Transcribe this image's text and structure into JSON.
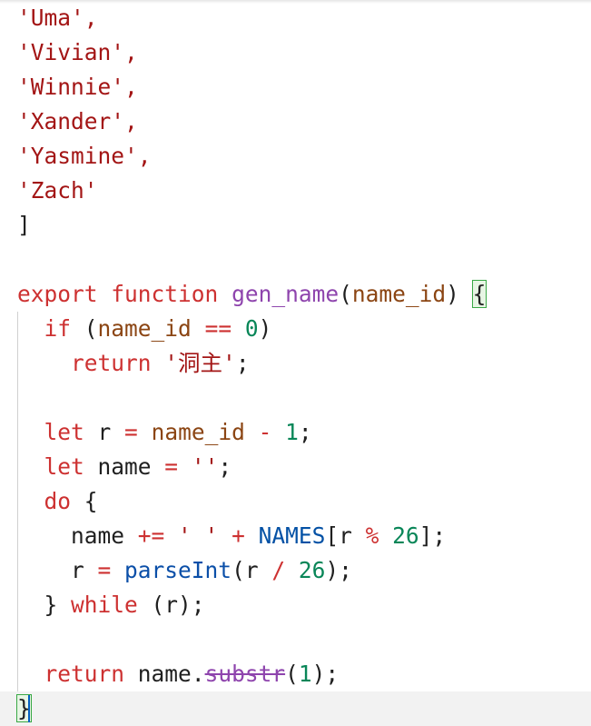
{
  "editor": {
    "names_tail": [
      "'Uma',",
      "'Vivian',",
      "'Winnie',",
      "'Xander',",
      "'Yasmine',",
      "'Zach'"
    ],
    "array_close": "]",
    "fn_decl": {
      "export_kw": "export",
      "function_kw": "function",
      "fn_name": "gen_name",
      "open_paren": "(",
      "param": "name_id",
      "close_paren": ")",
      "space": " ",
      "open_brace": "{"
    },
    "if_line": {
      "indent": "  ",
      "kw": "if",
      "open": " (",
      "var": "name_id",
      "op": " == ",
      "num": "0",
      "close": ")"
    },
    "return1": {
      "indent": "    ",
      "kw": "return",
      "space": " ",
      "str": "'洞主'",
      "semi": ";"
    },
    "let_r": {
      "indent": "  ",
      "kw": "let",
      "rest1": " r ",
      "op": "=",
      "space": " ",
      "var": "name_id",
      "op2": " - ",
      "num": "1",
      "semi": ";"
    },
    "let_name": {
      "indent": "  ",
      "kw": "let",
      "rest1": " name ",
      "op": "=",
      "space": " ",
      "str": "''",
      "semi": ";"
    },
    "do_line": {
      "indent": "  ",
      "kw": "do",
      "rest": " {"
    },
    "name_plus": {
      "indent": "    ",
      "var": "name",
      "op": " += ",
      "str": "' '",
      "op2": " + ",
      "const": "NAMES",
      "open": "[",
      "var2": "r",
      "op3": " % ",
      "num": "26",
      "close": "];"
    },
    "r_assign": {
      "indent": "    ",
      "var": "r",
      "op": " = ",
      "fn": "parseInt",
      "open": "(",
      "var2": "r",
      "op2": " / ",
      "num": "26",
      "close": ");"
    },
    "while_line": {
      "indent": "  ",
      "close": "} ",
      "kw": "while",
      "rest": " (r);"
    },
    "return2": {
      "indent": "  ",
      "kw": "return",
      "space": " ",
      "var": "name",
      "dot": ".",
      "method": "substr",
      "open": "(",
      "num": "1",
      "close": ");"
    },
    "final_brace": "}"
  }
}
